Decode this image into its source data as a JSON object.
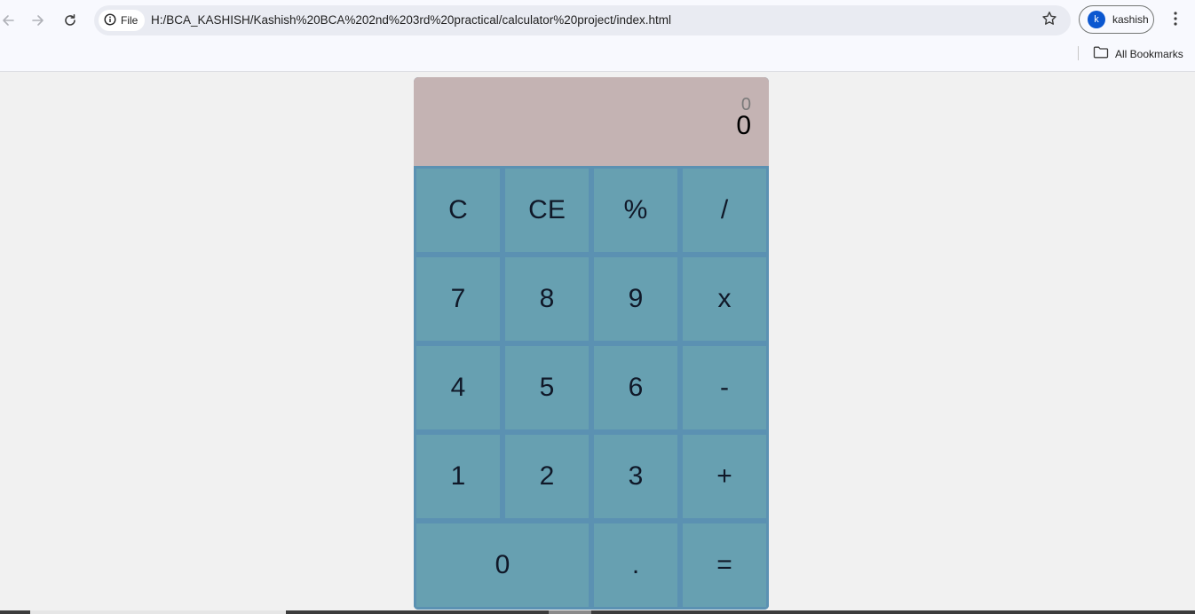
{
  "browser": {
    "site_chip_label": "File",
    "url": "H:/BCA_KASHISH/Kashish%20BCA%202nd%203rd%20practical/calculator%20project/index.html",
    "profile_initial": "k",
    "profile_name": "kashish",
    "bookmarks_label": "All Bookmarks",
    "icons": {
      "back": "back-arrow-icon",
      "forward": "forward-arrow-icon",
      "reload": "reload-icon",
      "site_info": "info-icon",
      "star": "star-icon",
      "menu": "kebab-menu-icon",
      "folder": "folder-icon"
    }
  },
  "calculator": {
    "display": {
      "previous": "0",
      "current": "0"
    },
    "keys": [
      {
        "label": "C",
        "name": "clear-button"
      },
      {
        "label": "CE",
        "name": "clear-entry-button"
      },
      {
        "label": "%",
        "name": "percent-button"
      },
      {
        "label": "/",
        "name": "divide-button"
      },
      {
        "label": "7",
        "name": "digit-7-button"
      },
      {
        "label": "8",
        "name": "digit-8-button"
      },
      {
        "label": "9",
        "name": "digit-9-button"
      },
      {
        "label": "x",
        "name": "multiply-button"
      },
      {
        "label": "4",
        "name": "digit-4-button"
      },
      {
        "label": "5",
        "name": "digit-5-button"
      },
      {
        "label": "6",
        "name": "digit-6-button"
      },
      {
        "label": "-",
        "name": "subtract-button"
      },
      {
        "label": "1",
        "name": "digit-1-button"
      },
      {
        "label": "2",
        "name": "digit-2-button"
      },
      {
        "label": "3",
        "name": "digit-3-button"
      },
      {
        "label": "+",
        "name": "add-button"
      },
      {
        "label": "0",
        "name": "digit-0-button"
      },
      {
        "label": ".",
        "name": "decimal-button"
      },
      {
        "label": "=",
        "name": "equals-button"
      }
    ],
    "colors": {
      "display_bg": "#c4b3b3",
      "key_bg": "#67a0b1",
      "key_border": "#5b91b2"
    }
  }
}
